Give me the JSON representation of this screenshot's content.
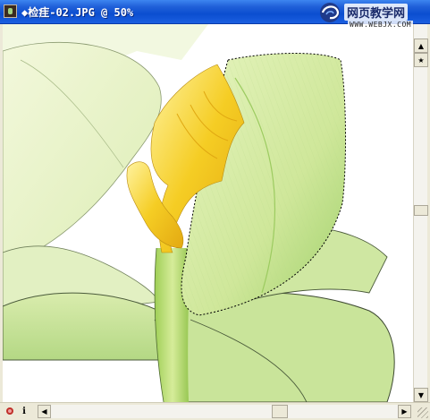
{
  "window": {
    "title": "◆检疰-02.JPG @ 50%",
    "app_icon": "photoshop-doc-icon"
  },
  "watermark": {
    "title": "网页教学网",
    "url": "WWW.WEBJX.COM",
    "logo_icon": "swirl-logo-icon"
  },
  "canvas": {
    "subject": "flower-illustration",
    "selection": "marching-ants-selection"
  },
  "vscroll": {
    "up_icon": "arrow-up-icon",
    "down_icon": "arrow-down-icon",
    "star_icon": "star-icon"
  },
  "statusbar": {
    "left_icon": "record-dot-icon",
    "info_label": "i",
    "left_arrow": "arrow-left-icon",
    "right_arrow": "arrow-right-icon"
  },
  "colors": {
    "titlebar": "#0b4ed0",
    "frame": "#ece9d8",
    "leaf_green": "#cfe6a0",
    "yellow": "#f2c21a"
  }
}
